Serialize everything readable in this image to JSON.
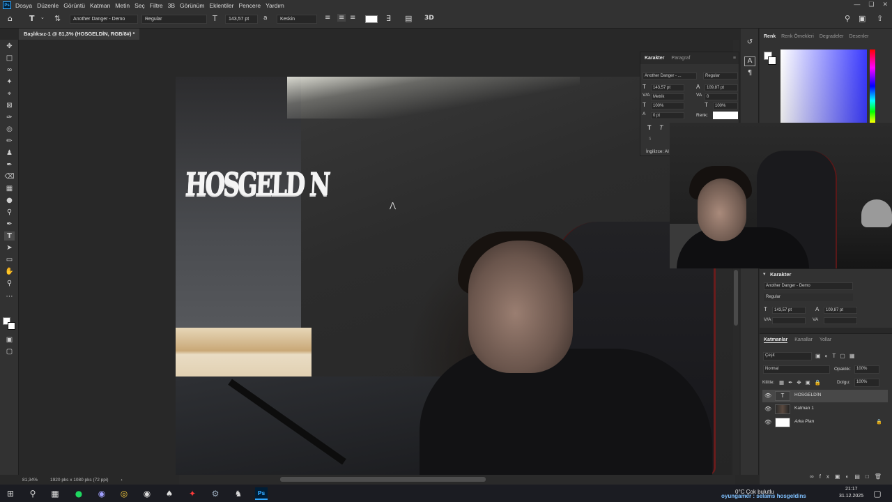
{
  "app": {
    "logo": "Ps"
  },
  "menu": [
    "Dosya",
    "Düzenle",
    "Görüntü",
    "Katman",
    "Metin",
    "Seç",
    "Filtre",
    "3B",
    "Görünüm",
    "Eklentiler",
    "Pencere",
    "Yardım"
  ],
  "options_bar": {
    "font_family": "Another Danger - Demo",
    "font_style": "Regular",
    "font_size": "143,57 pt",
    "antialias": "Keskin"
  },
  "document": {
    "tab_title": "Başlıksız-1 @ 81,3% (HOSGELDİN, RGB/8#) *",
    "canvas_text": "HOSGELD N"
  },
  "status": {
    "zoom": "81,34%",
    "doc_info": "1920 pks x 1080 pks (72 ppi)"
  },
  "character_panel": {
    "tabs": [
      "Karakter",
      "Paragraf"
    ],
    "font_family": "Another Danger - ...",
    "font_style": "Regular",
    "size": "143,57 pt",
    "leading": "109,87 pt",
    "kerning": "Metrik",
    "tracking": "0",
    "vscale": "100%",
    "hscale": "100%",
    "baseline": "0 pt",
    "color_label": "Renk:",
    "language": "İngilizce: AI"
  },
  "color_panel": {
    "tabs": [
      "Renk",
      "Renk Örnekleri",
      "Degradeler",
      "Desenler"
    ]
  },
  "properties_panel": {
    "title": "Karakter",
    "font_family": "Another Danger - Demo",
    "font_style": "Regular",
    "size": "143,57 pt",
    "leading": "109,87 pt",
    "kerning": "V/A",
    "tracking": "VA"
  },
  "layers_panel": {
    "tabs": [
      "Katmanlar",
      "Kanallar",
      "Yollar"
    ],
    "filter_label": "Çeşit",
    "blend_mode": "Normal",
    "opacity_label": "Opaklık:",
    "opacity_value": "100%",
    "lock_label": "Kilitle:",
    "fill_label": "Dolgu:",
    "fill_value": "100%",
    "layers": [
      {
        "name": "HOSGELDİN",
        "type": "text"
      },
      {
        "name": "Katman 1",
        "type": "image"
      },
      {
        "name": "Arka Plan",
        "type": "background"
      }
    ]
  },
  "taskbar": {
    "weather": "0°C  Çok bulutlu",
    "stream_text": "oyungamer : selams hosgeldins",
    "time": "21:17",
    "date": "31.12.2025"
  },
  "colors": {
    "ui_bg": "#323232",
    "canvas_bg": "#282828",
    "accent": "#31a8ff",
    "text_color": "#ffffff"
  }
}
